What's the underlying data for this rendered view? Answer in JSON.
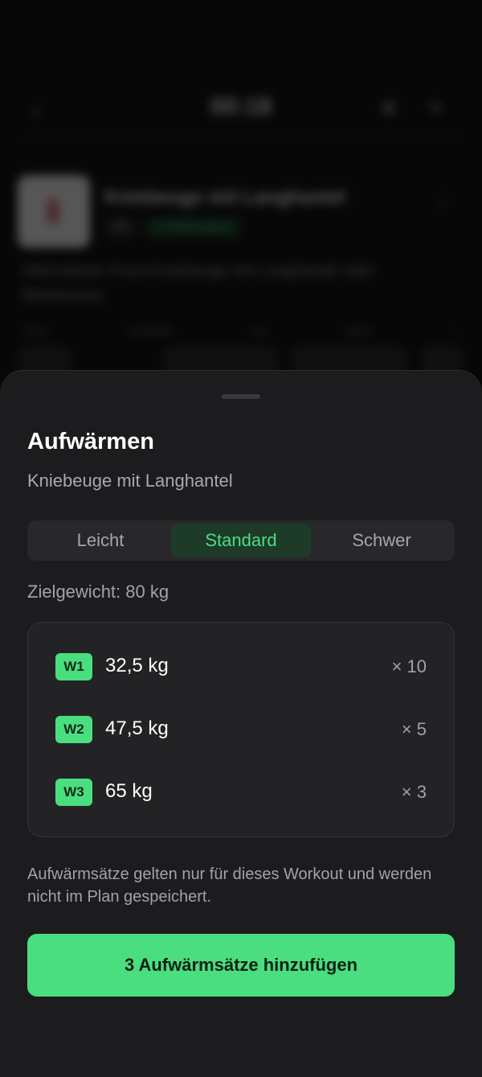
{
  "background": {
    "timer": "00:18",
    "exercise_title": "Kniebeuge mit Langhantel",
    "tag_secondary": "3S",
    "tag_primary": "3 Arbeitssätze",
    "description": "Alternativer Front-Kniebeuge mit Langhantel oder Beinpresse.",
    "columns": [
      "SATZ",
      "VORHER",
      "KG",
      "WDH",
      "✓"
    ]
  },
  "sheet": {
    "title": "Aufwärmen",
    "subtitle": "Kniebeuge mit Langhantel",
    "intensity_options": [
      "Leicht",
      "Standard",
      "Schwer"
    ],
    "selected_intensity": "Standard",
    "target_weight": "Zielgewicht: 80 kg",
    "sets": [
      {
        "badge": "W1",
        "weight": "32,5 kg",
        "reps": "× 10"
      },
      {
        "badge": "W2",
        "weight": "47,5 kg",
        "reps": "× 5"
      },
      {
        "badge": "W3",
        "weight": "65 kg",
        "reps": "× 3"
      }
    ],
    "info": "Aufwärmsätze gelten nur für dieses Workout und werden nicht im Plan gespeichert.",
    "cta_label": "3 Aufwärmsätze hinzufügen"
  },
  "colors": {
    "accent": "#4ade80",
    "sheet_bg": "#1c1c1e",
    "card_bg": "#232326"
  }
}
